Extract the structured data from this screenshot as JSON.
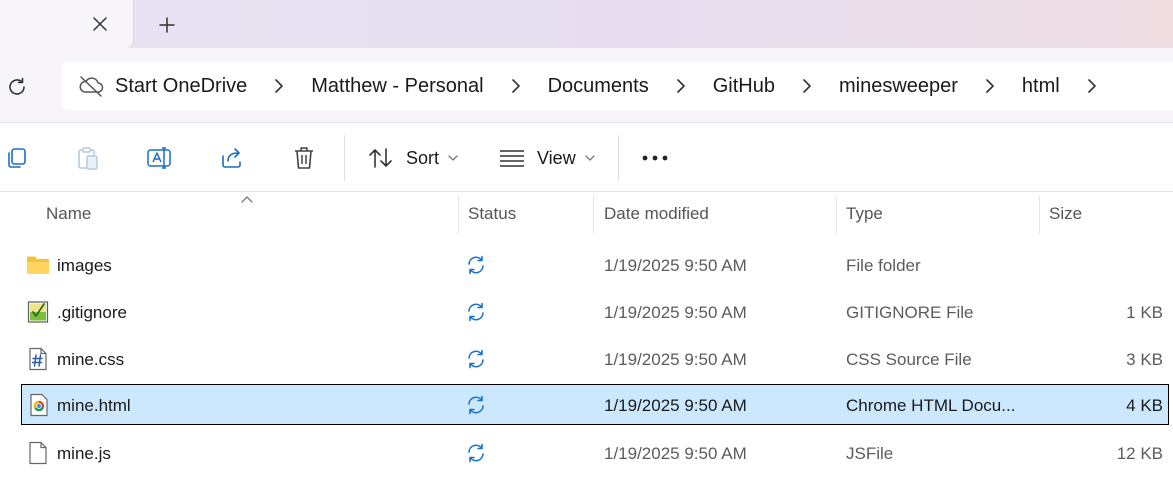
{
  "tabs": {
    "close_icon": "close-icon",
    "add_icon": "plus-icon"
  },
  "address": {
    "refresh_icon": "refresh-icon",
    "onedrive_icon": "cloud-offline-icon",
    "crumbs": [
      "Start OneDrive",
      "Matthew - Personal",
      "Documents",
      "GitHub",
      "minesweeper",
      "html"
    ]
  },
  "toolbar": {
    "sort_label": "Sort",
    "view_label": "View",
    "more_label": "..."
  },
  "columns": {
    "name": "Name",
    "status": "Status",
    "date": "Date modified",
    "type": "Type",
    "size": "Size"
  },
  "files": [
    {
      "name": "images",
      "date": "1/19/2025 9:50 AM",
      "type": "File folder",
      "size": "",
      "icon": "folder-icon"
    },
    {
      "name": ".gitignore",
      "date": "1/19/2025 9:50 AM",
      "type": "GITIGNORE File",
      "size": "1 KB",
      "icon": "gitignore-file-icon"
    },
    {
      "name": "mine.css",
      "date": "1/19/2025 9:50 AM",
      "type": "CSS Source File",
      "size": "3 KB",
      "icon": "css-file-icon"
    },
    {
      "name": "mine.html",
      "date": "1/19/2025 9:50 AM",
      "type": "Chrome HTML Docu...",
      "size": "4 KB",
      "icon": "chrome-html-file-icon",
      "selected": true
    },
    {
      "name": "mine.js",
      "date": "1/19/2025 9:50 AM",
      "type": "JSFile",
      "size": "12 KB",
      "icon": "generic-file-icon"
    }
  ],
  "colors": {
    "accent": "#1a6ec4",
    "selection": "#cce8ff",
    "sync": "#1a73c9",
    "folder": "#f5c23e"
  }
}
